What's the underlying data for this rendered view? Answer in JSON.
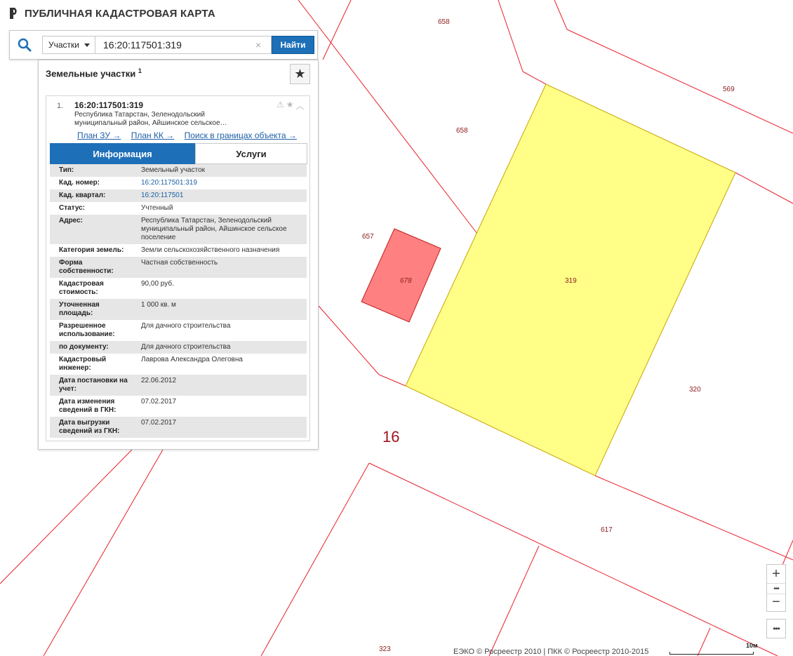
{
  "app": {
    "title": "ПУБЛИЧНАЯ КАДАСТРОВАЯ КАРТА"
  },
  "search": {
    "type_label": "Участки",
    "value": "16:20:117501:319",
    "clear_label": "×",
    "find_label": "Найти"
  },
  "panel": {
    "title": "Земельные участки",
    "count": "1",
    "result": {
      "index": "1.",
      "kn": "16:20:117501:319",
      "address_short": "Республика Татарстан, Зеленодольский муниципальный район, Айшинское сельское…",
      "links": {
        "plan_zu": "План ЗУ →",
        "plan_kk": "План КК →",
        "search_bounds": "Поиск в границах объекта →"
      },
      "tabs": {
        "info": "Информация",
        "services": "Услуги"
      },
      "fields": [
        {
          "key": "Тип:",
          "value": "Земельный участок"
        },
        {
          "key": "Кад. номер:",
          "value": "16:20:117501:319"
        },
        {
          "key": "Кад. квартал:",
          "value": "16:20:117501"
        },
        {
          "key": "Статус:",
          "value": "Учтенный"
        },
        {
          "key": "Адрес:",
          "value": "Республика Татарстан, Зеленодольский муниципальный район, Айшинское сельское поселение"
        },
        {
          "key": "Категория земель:",
          "value": "Земли сельскохозяйственного назначения"
        },
        {
          "key": "Форма собственности:",
          "value": "Частная собственность"
        },
        {
          "key": "Кадастровая стоимость:",
          "value": "90,00 руб."
        },
        {
          "key": "Уточненная площадь:",
          "value": "1 000 кв. м"
        },
        {
          "key": "Разрешенное использование:",
          "value": "Для дачного строительства"
        },
        {
          "key": "по документу:",
          "value": "Для дачного строительства"
        },
        {
          "key": "Кадастровый инженер:",
          "value": "Лаврова Александра Олеговна"
        },
        {
          "key": "Дата постановки на учет:",
          "value": "22.06.2012"
        },
        {
          "key": "Дата изменения сведений в ГКН:",
          "value": "07.02.2017"
        },
        {
          "key": "Дата выгрузки сведений из ГКН:",
          "value": "07.02.2017"
        }
      ]
    }
  },
  "map": {
    "parcel_labels": {
      "p658a": "658",
      "p658b": "658",
      "p569": "569",
      "p657": "657",
      "p678": "678",
      "p319": "319",
      "p320": "320",
      "p617": "617",
      "p323": "323"
    },
    "block_number": "16",
    "colors": {
      "boundary": "#e8202a",
      "selected_fill": "#ffff88",
      "selected_stroke": "#c8a400",
      "building_fill": "#ff8080",
      "block_label": "#a0141e"
    }
  },
  "controls": {
    "zoom_in": "+",
    "zoom_more": "•••",
    "zoom_out": "−",
    "more": "•••"
  },
  "footer": {
    "copyright": "ЕЭКО © Росреестр 2010 | ПКК © Росреестр 2010-2015",
    "scale": "10м"
  }
}
